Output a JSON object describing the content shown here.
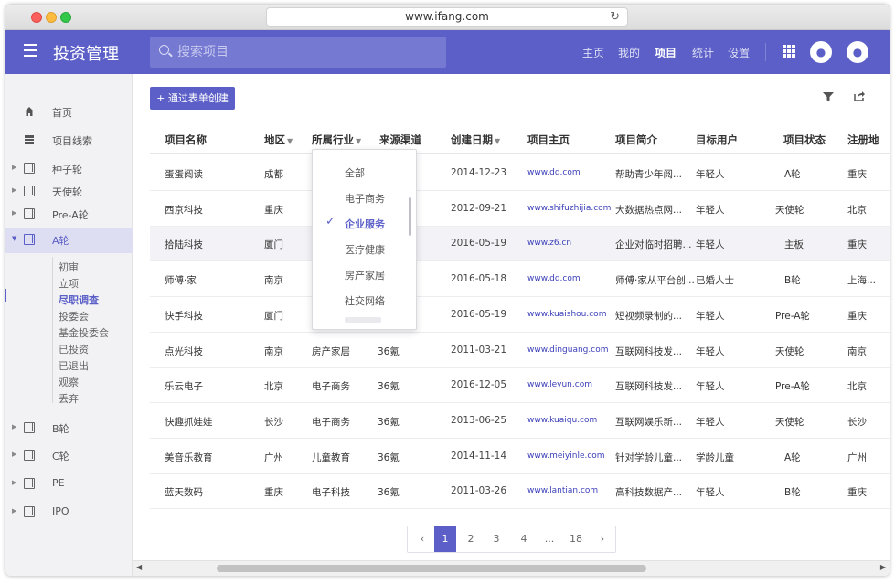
{
  "browser": {
    "url": "www.ifang.com",
    "reload_icon": "reload-icon"
  },
  "appbar": {
    "title": "投资管理",
    "search_placeholder": "搜索项目",
    "nav": [
      "主页",
      "我的",
      "项目",
      "统计",
      "设置"
    ],
    "active_nav": "项目",
    "accent": "#5b5fc7"
  },
  "sidebar": {
    "items": [
      {
        "label": "首页",
        "icon": "home-icon"
      },
      {
        "label": "项目线索",
        "icon": "list-icon"
      },
      {
        "label": "种子轮",
        "icon": "film-icon"
      },
      {
        "label": "天使轮",
        "icon": "film-icon"
      },
      {
        "label": "Pre-A轮",
        "icon": "film-icon"
      },
      {
        "label": "A轮",
        "icon": "film-icon"
      },
      {
        "label": "B轮",
        "icon": "film-icon"
      },
      {
        "label": "C轮",
        "icon": "film-icon"
      },
      {
        "label": "PE",
        "icon": "film-icon"
      },
      {
        "label": "IPO",
        "icon": "film-icon"
      }
    ],
    "active": "A轮",
    "sub_items": [
      "初审",
      "立项",
      "尽职调查",
      "投委会",
      "基金投委会",
      "已投资",
      "已退出",
      "观察",
      "丢弃"
    ],
    "active_sub": "尽职调查"
  },
  "toolbar": {
    "create_label": "+ 通过表单创建"
  },
  "table": {
    "columns": [
      "项目名称",
      "地区",
      "所属行业",
      "来源渠道",
      "创建日期",
      "项目主页",
      "项目简介",
      "目标用户",
      "项目状态",
      "注册地"
    ],
    "rows": [
      [
        "蛋蛋阅读",
        "成都",
        "",
        "",
        "2014-12-23",
        "www.dd.com",
        "帮助青少年阅...",
        "年轻人",
        "A轮",
        "重庆"
      ],
      [
        "西京科技",
        "重庆",
        "",
        "",
        "2012-09-21",
        "www.shifuzhijia.com",
        "大数据热点网...",
        "年轻人",
        "天使轮",
        "北京"
      ],
      [
        "拾陆科技",
        "厦门",
        "",
        "",
        "2016-05-19",
        "www.z6.cn",
        "企业对临时招聘...",
        "年轻人",
        "主板",
        "重庆"
      ],
      [
        "师傅·家",
        "南京",
        "",
        "",
        "2016-05-18",
        "www.dd.com",
        "师傅·家从平台创...",
        "已婚人士",
        "B轮",
        "上海..."
      ],
      [
        "快手科技",
        "厦门",
        "",
        "",
        "2016-05-19",
        "www.kuaishou.com",
        "短视频录制的...",
        "年轻人",
        "Pre-A轮",
        "重庆"
      ],
      [
        "点光科技",
        "南京",
        "房产家居",
        "36氪",
        "2011-03-21",
        "www.dinguang.com",
        "互联网科技发...",
        "年轻人",
        "天使轮",
        "南京"
      ],
      [
        "乐云电子",
        "北京",
        "电子商务",
        "36氪",
        "2016-12-05",
        "www.leyun.com",
        "互联网科技发...",
        "年轻人",
        "Pre-A轮",
        "北京"
      ],
      [
        "快趣抓娃娃",
        "长沙",
        "电子商务",
        "36氪",
        "2013-06-25",
        "www.kuaiqu.com",
        "互联网娱乐新...",
        "年轻人",
        "天使轮",
        "长沙"
      ],
      [
        "美音乐教育",
        "广州",
        "儿童教育",
        "36氪",
        "2014-11-14",
        "www.meiyinle.com",
        "针对学龄儿童...",
        "学龄儿童",
        "A轮",
        "广州"
      ],
      [
        "蓝天数码",
        "重庆",
        "电子科技",
        "36氪",
        "2011-03-26",
        "www.lantian.com",
        "高科技数据产...",
        "年轻人",
        "B轮",
        "重庆"
      ]
    ]
  },
  "industry_dropdown": {
    "options": [
      "全部",
      "电子商务",
      "企业服务",
      "医疗健康",
      "房产家居",
      "社交网络"
    ],
    "selected": "企业服务"
  },
  "pagination": {
    "pages": [
      "‹",
      "1",
      "2",
      "3",
      "4",
      "...",
      "18",
      "›"
    ],
    "current": "1"
  }
}
